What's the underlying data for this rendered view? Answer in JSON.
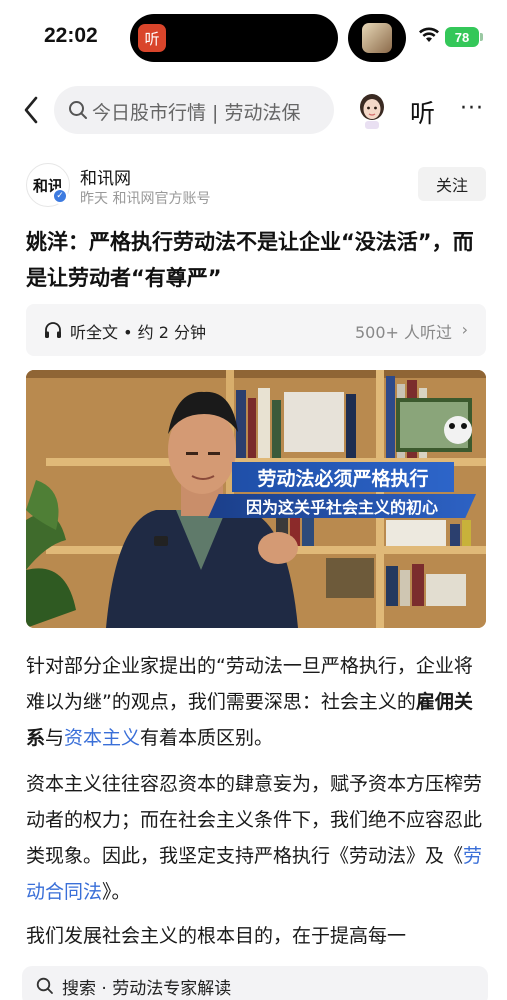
{
  "status_bar": {
    "time": "22:02",
    "island_app_label": "听",
    "battery": "78",
    "battery_color": "#34c759"
  },
  "nav": {
    "search_text": "今日股市行情 | 劳动法保",
    "listen_label": "听",
    "more_label": "···"
  },
  "author": {
    "logo_text": "和讯",
    "name": "和讯网",
    "meta": "昨天  和讯网官方账号",
    "follow_label": "关注"
  },
  "article": {
    "title": "姚洋：严格执行劳动法不是让企业“没法活”，而是让劳动者“有尊严”",
    "listen_bar": {
      "label": "听全文 • 约 2 分钟",
      "count": "500+ 人听过"
    },
    "video": {
      "caption_line1": "劳动法必须严格执行",
      "caption_line2": "因为这关乎社会主义的初心"
    },
    "p1": {
      "part1": "针对部分企业家提出的“劳动法一旦严格执行，企业将难以为继”的观点，我们需要深思：社会主义的",
      "bold": "雇佣关系",
      "part2": "与",
      "link": "资本主义",
      "part3": "有着本质区别。"
    },
    "p2": {
      "part1": "资本主义往往容忍资本的肆意妄为，赋予资本方压榨劳动者的权力；而在社会主义条件下，我们绝不应容忍此类现象。因此，我坚定支持严格执行《劳动法》及《",
      "link": "劳动合同法",
      "part2": "》。"
    },
    "p3": "我们发展社会主义的根本目的，在于提高每一"
  },
  "bottom_search": {
    "text": "搜索 · 劳动法专家解读"
  },
  "colors": {
    "accent_link": "#3a6fd8",
    "verified_badge": "#3d7be0",
    "caption_blue": "#1f4fa8"
  },
  "icons": [
    "back-chevron-icon",
    "search-icon",
    "avatar-icon",
    "headphone-icon",
    "chevron-right-icon",
    "wifi-icon",
    "verified-icon"
  ]
}
